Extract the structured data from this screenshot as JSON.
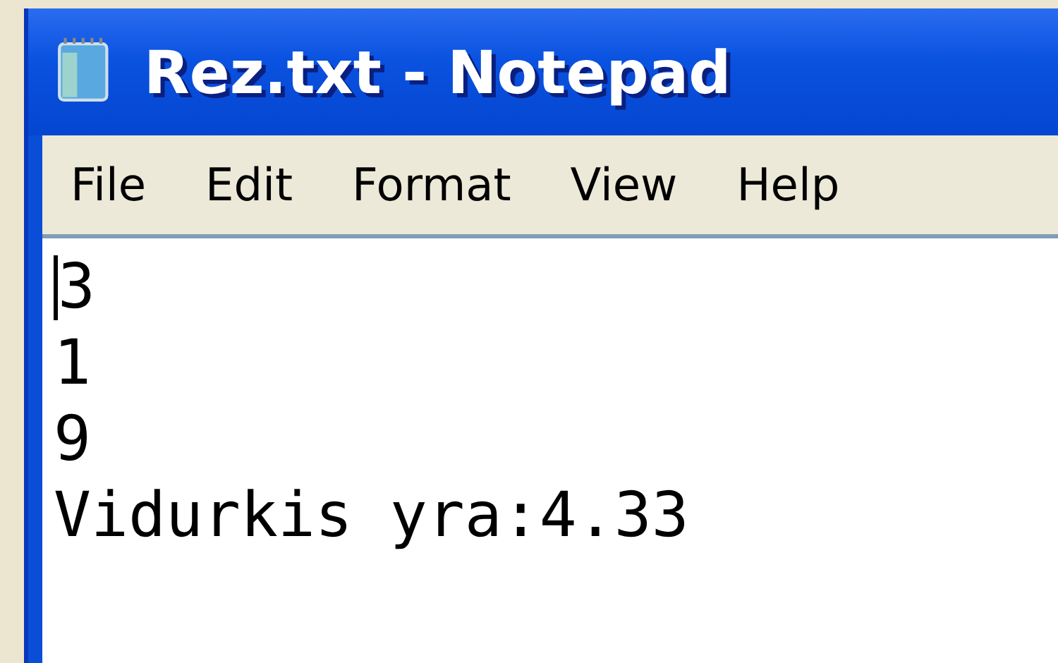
{
  "window": {
    "title": "Rez.txt - Notepad"
  },
  "menu": [
    {
      "label": "File"
    },
    {
      "label": "Edit"
    },
    {
      "label": "Format"
    },
    {
      "label": "View"
    },
    {
      "label": "Help"
    }
  ],
  "editor": {
    "lines": [
      "3",
      "1",
      "9",
      "Vidurkis yra:4.33"
    ]
  }
}
